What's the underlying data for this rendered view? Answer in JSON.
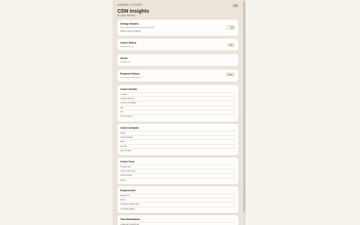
{
  "header": {
    "brand": "ARAMAL CODES",
    "title": "CDN Insights",
    "subtitle": "No page detected",
    "chip": "URL"
  },
  "debug_headers": {
    "title": "Debug Headers",
    "desc": "Inject Akamai pragma headers for this tab",
    "sub": "Header injection disabled"
  },
  "cache_status": {
    "title": "Cache Status",
    "sub": "No response yet",
    "badge": "N/A"
  },
  "alerts": {
    "title": "Alerts",
    "sub": "No alerts yet"
  },
  "request_history": {
    "title": "Request History",
    "sub": "No requests captured yet",
    "button": "Clear"
  },
  "cache_details": {
    "title": "Cache Details",
    "rows": [
      "X-Cache",
      "X-Cache-Remote",
      "X-Check-Cacheable",
      "Age",
      "TTL",
      "TTL Remaining"
    ]
  },
  "cache_analysis": {
    "title": "Cache Analysis",
    "rows": [
      "Status",
      "Cache Enabled",
      "Stale",
      "Key Diff",
      "Key Changes"
    ]
  },
  "cache_keys": {
    "title": "Cache Keys",
    "rows": [
      "X-Cache-Key",
      "X-True-Cache-Key",
      "Cache Control",
      "Expires"
    ]
  },
  "request_info": {
    "title": "Request Info",
    "rows": [
      "Request ID",
      "Server",
      "X-Akamai-Session-Info",
      "X-Akamai-Staging"
    ]
  },
  "transformations": {
    "title": "Transformations",
    "rows": [
      "X-Akamai-Transformed"
    ]
  },
  "icons": {
    "chevron": "chevron-down-icon"
  }
}
